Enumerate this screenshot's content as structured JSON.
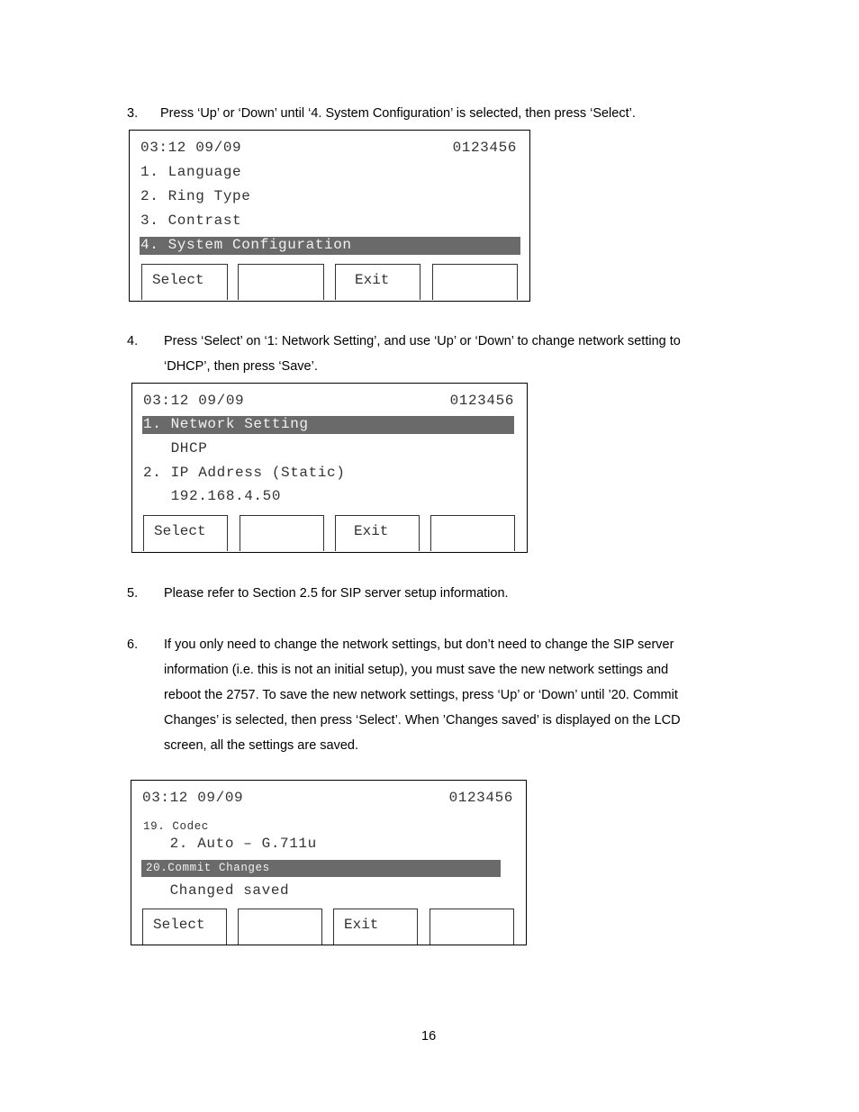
{
  "steps": [
    {
      "num": "3.",
      "lines": [
        "Press ‘Up’ or ‘Down’ until ‘4. System Configuration’ is selected, then press ‘Select’."
      ]
    },
    {
      "num": "4.",
      "lines": [
        "Press ‘Select’ on ‘1: Network Setting’, and use ‘Up’ or ‘Down’    to change network setting to",
        "‘DHCP’, then press ‘Save’."
      ]
    },
    {
      "num": "5.",
      "lines": [
        "Please refer to Section 2.5 for SIP server setup information."
      ]
    },
    {
      "num": "6.",
      "lines": [
        "If you only need to change the network settings, but don’t need to change the SIP server",
        "information (i.e. this is not an initial setup), you must save the new network settings and",
        "reboot the 2757. To save the new network settings, press ‘Up’ or ‘Down’ until ’20. Commit",
        "Changes’ is selected, then press ‘Select’. When ’Changes saved’ is displayed on the LCD",
        "screen, all the settings are saved."
      ]
    }
  ],
  "screens": [
    {
      "time": "03:12 09/09",
      "number": "0123456",
      "lines": [
        "1. Language",
        "2. Ring Type",
        "3. Contrast",
        "4. System Configuration"
      ],
      "highlighted": "4. System Configuration",
      "softkeys": [
        "Select",
        "",
        "Exit",
        ""
      ]
    },
    {
      "time": "03:12 09/09",
      "number": "0123456",
      "lines": [
        "1. Network Setting",
        "   DHCP",
        "2. IP Address (Static)",
        "   192.168.4.50"
      ],
      "highlighted": "1. Network Setting",
      "softkeys": [
        "Select",
        "",
        "Exit",
        ""
      ]
    },
    {
      "time": "03:12 09/09",
      "number": "0123456",
      "lines": [
        "19. Codec",
        "   2. Auto – G.711u",
        "20.Commit Changes",
        "   Changed saved"
      ],
      "highlighted": "20.Commit Changes",
      "softkeys": [
        "Select",
        "",
        "Exit",
        ""
      ]
    }
  ],
  "page_number": "16",
  "colors": {
    "highlight": "#6a6a6a",
    "highlight_text": "#f2f2f2"
  }
}
